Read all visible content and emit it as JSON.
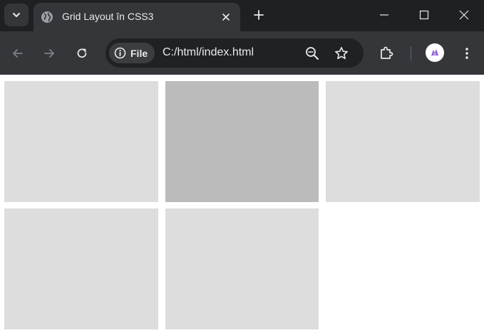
{
  "browser": {
    "tab": {
      "title": "Grid Layout în CSS3",
      "favicon": "globe-icon"
    },
    "omnibox": {
      "chip_label": "File",
      "url": "C:/html/index.html"
    },
    "colors": {
      "titlebar": "#1f2023",
      "toolbar": "#35363a",
      "omnibox": "#202124",
      "text": "#e8eaed"
    }
  },
  "page": {
    "grid_items": [
      {
        "state": "default",
        "color": "#dddddd"
      },
      {
        "state": "hover",
        "color": "#bbbbbb"
      },
      {
        "state": "default",
        "color": "#dddddd"
      },
      {
        "state": "default",
        "color": "#dddddd"
      },
      {
        "state": "default",
        "color": "#dddddd"
      }
    ]
  }
}
